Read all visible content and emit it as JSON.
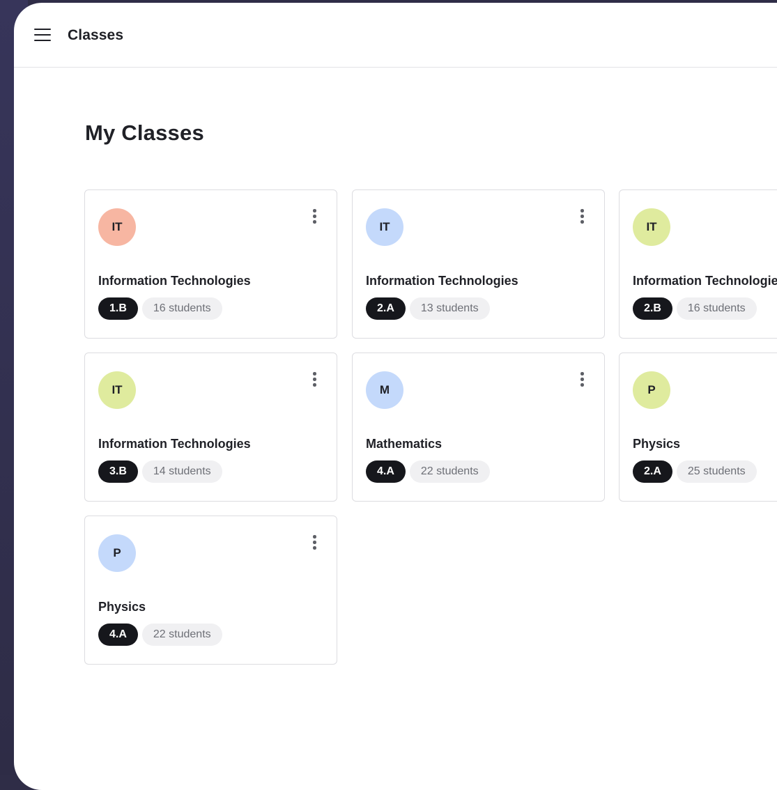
{
  "appbar": {
    "title": "Classes",
    "menu_icon": "menu-icon"
  },
  "page": {
    "title": "My Classes"
  },
  "colors": {
    "salmon": "#f7b6a2",
    "blue": "#c4d9fb",
    "lime": "#dfeb9e"
  },
  "cards": [
    {
      "initials": "IT",
      "subject": "Information Technologies",
      "class": "1.B",
      "students": "16 students",
      "avatar_color": "#f7b6a2"
    },
    {
      "initials": "IT",
      "subject": "Information Technologies",
      "class": "2.A",
      "students": "13 students",
      "avatar_color": "#c4d9fb"
    },
    {
      "initials": "IT",
      "subject": "Information Technologies",
      "class": "2.B",
      "students": "16 students",
      "avatar_color": "#dfeb9e"
    },
    {
      "initials": "IT",
      "subject": "Information Technologies",
      "class": "3.B",
      "students": "14 students",
      "avatar_color": "#dfeb9e"
    },
    {
      "initials": "M",
      "subject": "Mathematics",
      "class": "4.A",
      "students": "22 students",
      "avatar_color": "#c4d9fb"
    },
    {
      "initials": "P",
      "subject": "Physics",
      "class": "2.A",
      "students": "25 students",
      "avatar_color": "#dfeb9e"
    },
    {
      "initials": "P",
      "subject": "Physics",
      "class": "4.A",
      "students": "22 students",
      "avatar_color": "#c4d9fb"
    }
  ]
}
